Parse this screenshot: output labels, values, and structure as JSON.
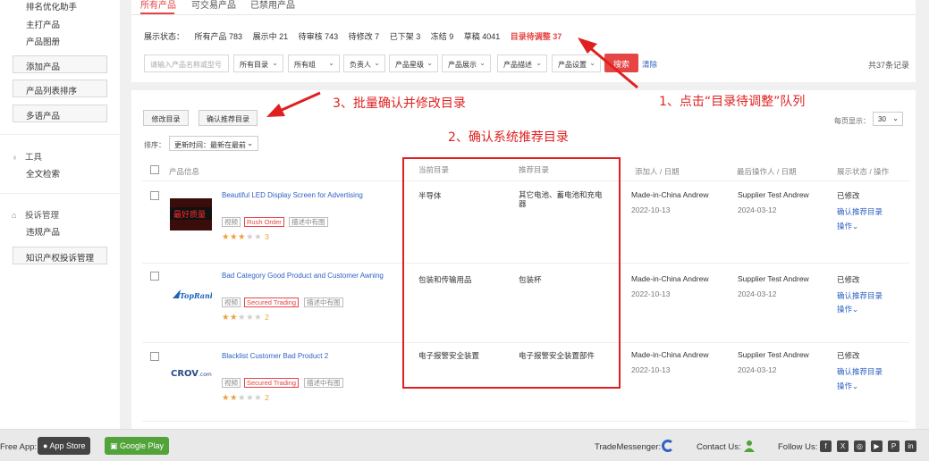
{
  "sidebar": {
    "links_top": [
      "排名优化助手",
      "主打产品",
      "产品图册"
    ],
    "buttons": [
      "添加产品",
      "产品列表排序",
      "多语产品"
    ],
    "tools": {
      "title": "工具",
      "links": [
        "全文检索"
      ]
    },
    "complaints": {
      "title": "投诉管理",
      "links": [
        "违规产品"
      ],
      "button": "知识产权投诉管理"
    }
  },
  "tabs": [
    "所有产品",
    "可交易产品",
    "已禁用产品"
  ],
  "status": {
    "label": "展示状态：",
    "items": [
      "所有产品 783",
      "展示中 21",
      "待审核 743",
      "待修改 7",
      "已下架 3",
      "冻结 9",
      "草稿 4041"
    ],
    "highlight": "目录待调整 37"
  },
  "filters": {
    "placeholder": "请输入产品名称或型号",
    "dropdowns": [
      "所有目录",
      "所有组",
      "负责人",
      "产品星级",
      "产品展示",
      "产品描述",
      "产品设置"
    ],
    "search": "搜索",
    "clear": "清除",
    "total": "共37条记录"
  },
  "toolbar": {
    "modify": "修改目录",
    "confirm": "确认推荐目录",
    "per_page_label": "每页显示：",
    "per_page": "30",
    "sort_label": "排序：",
    "sort_value": "更新时间：最新在最前"
  },
  "columns": [
    "产品信息",
    "当前目录",
    "推荐目录",
    "添加人 / 日期",
    "最后操作人 / 日期",
    "展示状态 / 操作"
  ],
  "rows": [
    {
      "title": "Beautiful LED Display Screen for Advertising",
      "tags": [
        "视频",
        "Rush Order",
        "描述中有图"
      ],
      "stars": 3,
      "current": "半导体",
      "recommended": "其它电池、蓄电池和充电器",
      "added_by": "Made-in-China Andrew",
      "added_date": "2022-10-13",
      "last_by": "Supplier Test Andrew",
      "last_date": "2024-03-12",
      "status": "已修改",
      "action": "确认推荐目录",
      "more": "操作"
    },
    {
      "title": "Bad Category Good Product and Customer Awning",
      "tags": [
        "视频",
        "Secured Trading",
        "描述中有图"
      ],
      "stars": 2,
      "current": "包装和传输用品",
      "recommended": "包装杯",
      "added_by": "Made-in-China Andrew",
      "added_date": "2022-10-13",
      "last_by": "Supplier Test Andrew",
      "last_date": "2024-03-12",
      "status": "已修改",
      "action": "确认推荐目录",
      "more": "操作"
    },
    {
      "title": "Blacklist Customer Bad Product 2",
      "tags": [
        "视频",
        "Secured Trading",
        "描述中有图"
      ],
      "stars": 2,
      "current": "电子报警安全装置",
      "recommended": "电子报警安全装置部件",
      "added_by": "Made-in-China Andrew",
      "added_date": "2022-10-13",
      "last_by": "Supplier Test Andrew",
      "last_date": "2024-03-12",
      "status": "已修改",
      "action": "确认推荐目录",
      "more": "操作"
    }
  ],
  "annotations": {
    "step1": "1、点击“目录待调整”队列",
    "step2": "2、确认系统推荐目录",
    "step3": "3、批量确认并修改目录"
  },
  "footer": {
    "app_label": "Free App:",
    "app_store": "App Store",
    "google_play": "Google Play",
    "trade_messenger": "TradeMessenger:",
    "contact": "Contact Us:",
    "follow": "Follow Us:"
  },
  "colors": {
    "accent": "#e64545",
    "link": "#2f62c5",
    "star": "#e9a23b",
    "annotation": "#e02020"
  }
}
